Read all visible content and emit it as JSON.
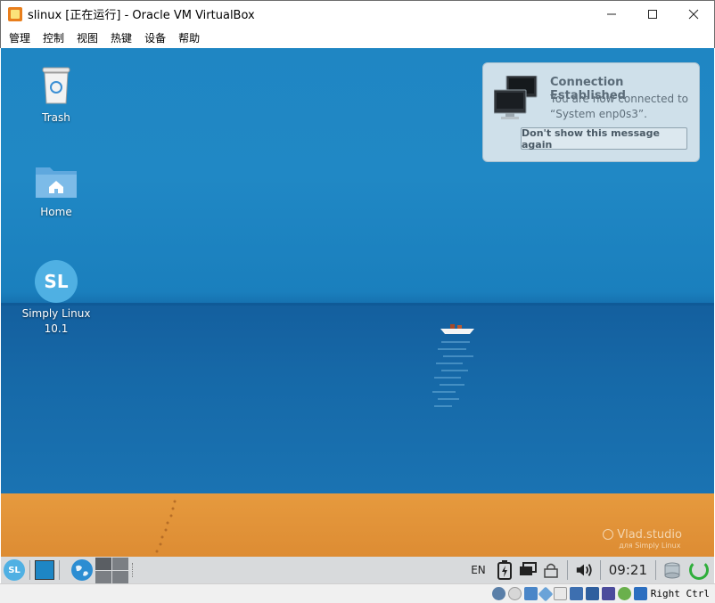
{
  "window": {
    "title": "slinux [正在运行] - Oracle VM VirtualBox",
    "minimize": "—",
    "maximize": "☐",
    "close": "✕"
  },
  "menu": {
    "items": [
      "管理",
      "控制",
      "视图",
      "热键",
      "设备",
      "帮助"
    ]
  },
  "desktop": {
    "icons": [
      {
        "label": "Trash",
        "icon": "trash-icon"
      },
      {
        "label": "Home",
        "icon": "home-folder-icon"
      },
      {
        "label": "Simply Linux\n10.1",
        "icon": "simply-linux-icon",
        "glyph": "SL"
      }
    ],
    "watermark": {
      "main": "Vlad.studio",
      "sub": "для Simply Linux"
    }
  },
  "notification": {
    "title": "Connection Established",
    "body": "You are now connected to “System enp0s3”.",
    "button": "Don't show this message again",
    "icon": "network-computers-icon"
  },
  "taskbar": {
    "start_glyph": "SL",
    "language": "EN",
    "clock": "09:21",
    "icons": [
      "battery-charging-icon",
      "display-icon",
      "keyboard-layout-icon",
      "volume-icon",
      "disk-icon",
      "power-icon"
    ]
  },
  "statusbar": {
    "host_key": "Right Ctrl",
    "icons": [
      "hdd-icon",
      "optical-disk-icon",
      "network-icon",
      "usb-icon",
      "shared-folder-icon",
      "display-icon",
      "recording-icon",
      "cpu-icon",
      "mouse-integration-icon",
      "keyboard-capture-icon"
    ]
  },
  "colors": {
    "sky": "#1f86c3",
    "sea": "#145f9e",
    "sand": "#e69a3e",
    "accent": "#4fb0e3"
  }
}
